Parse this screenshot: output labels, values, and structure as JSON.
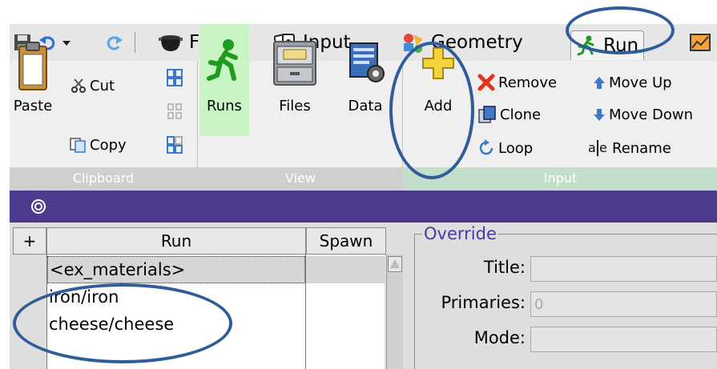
{
  "menu": {
    "flair": "Flair",
    "input": "Input",
    "geometry": "Geometry",
    "run": "Run"
  },
  "ribbon": {
    "paste": "Paste",
    "cut": "Cut",
    "copy": "Copy",
    "runs": "Runs",
    "files": "Files",
    "data": "Data",
    "add": "Add",
    "remove": "Remove",
    "clone": "Clone",
    "loop": "Loop",
    "move_up": "Move Up",
    "move_down": "Move Down",
    "rename": "Rename"
  },
  "groups": {
    "clipboard": "Clipboard",
    "view": "View",
    "input": "Input"
  },
  "table": {
    "add_col": "+",
    "run_header": "Run",
    "spawn_header": "Spawn",
    "rows": [
      "<ex_materials>",
      "iron/iron",
      "cheese/cheese"
    ]
  },
  "override": {
    "title": "Override",
    "title_label": "Title:",
    "primaries_label": "Primaries:",
    "primaries_value": "0",
    "mode_label": "Mode:"
  },
  "colors": {
    "accent": "#4e3a8e",
    "annotation": "#2f5d9a",
    "runs_active": "#c8f5c3"
  }
}
